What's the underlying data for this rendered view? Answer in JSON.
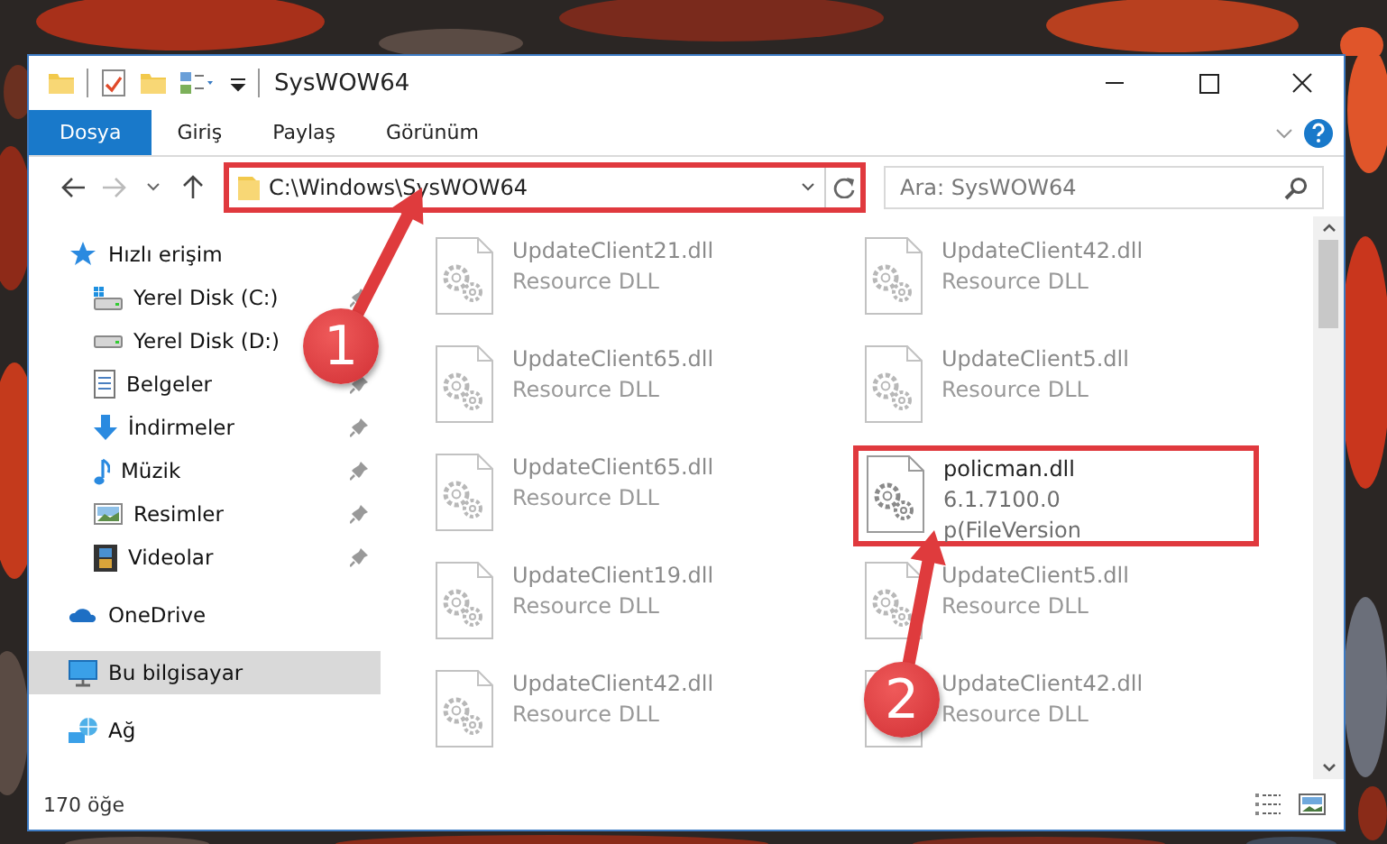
{
  "window": {
    "title": "SysWOW64"
  },
  "ribbon_tabs": [
    {
      "label": "Dosya",
      "selected": true
    },
    {
      "label": "Giriş",
      "selected": false
    },
    {
      "label": "Paylaş",
      "selected": false
    },
    {
      "label": "Görünüm",
      "selected": false
    }
  ],
  "address_bar": {
    "path": "C:\\Windows\\SysWOW64",
    "highlighted": true
  },
  "search": {
    "placeholder": "Ara: SysWOW64"
  },
  "sidebar": {
    "items": [
      {
        "label": "Hızlı erişim",
        "kind": "star",
        "selected": false,
        "children": [
          {
            "label": "Yerel Disk (C:)",
            "kind": "windrive",
            "pinned": true,
            "selected": false
          },
          {
            "label": "Yerel Disk (D:)",
            "kind": "drive",
            "selected": false
          },
          {
            "label": "Belgeler",
            "kind": "document",
            "pinned": true,
            "selected": false
          },
          {
            "label": "İndirmeler",
            "kind": "download",
            "pinned": true,
            "selected": false
          },
          {
            "label": "Müzik",
            "kind": "music",
            "pinned": true,
            "selected": false
          },
          {
            "label": "Resimler",
            "kind": "pictures",
            "pinned": true,
            "selected": false
          },
          {
            "label": "Videolar",
            "kind": "video",
            "pinned": true,
            "selected": false
          }
        ]
      },
      {
        "label": "OneDrive",
        "kind": "cloud",
        "selected": false
      },
      {
        "label": "Bu bilgisayar",
        "kind": "computer",
        "selected": true
      },
      {
        "label": "Ağ",
        "kind": "network",
        "selected": false
      }
    ]
  },
  "files": [
    {
      "name": "UpdateClient21.dll",
      "details": [
        "Resource DLL"
      ],
      "blurred": true,
      "highlighted": false
    },
    {
      "name": "UpdateClient42.dll",
      "details": [
        "Resource DLL"
      ],
      "blurred": true,
      "highlighted": false
    },
    {
      "name": "UpdateClient65.dll",
      "details": [
        "Resource DLL"
      ],
      "blurred": true,
      "highlighted": false
    },
    {
      "name": "UpdateClient5.dll",
      "details": [
        "Resource DLL"
      ],
      "blurred": true,
      "highlighted": false
    },
    {
      "name": "UpdateClient65.dll",
      "details": [
        "Resource DLL"
      ],
      "blurred": true,
      "highlighted": false
    },
    {
      "name": "policman.dll",
      "details": [
        "6.1.7100.0",
        "p(FileVersion"
      ],
      "blurred": false,
      "highlighted": true
    },
    {
      "name": "UpdateClient19.dll",
      "details": [
        "Resource DLL"
      ],
      "blurred": true,
      "highlighted": false
    },
    {
      "name": "UpdateClient5.dll",
      "details": [
        "Resource DLL"
      ],
      "blurred": true,
      "highlighted": false
    },
    {
      "name": "UpdateClient42.dll",
      "details": [
        "Resource DLL"
      ],
      "blurred": true,
      "highlighted": false
    },
    {
      "name": "UpdateClient42.dll",
      "details": [
        "Resource DLL"
      ],
      "blurred": true,
      "highlighted": false
    }
  ],
  "status_bar": {
    "item_count": "170 öğe"
  },
  "annotations": [
    {
      "number": "1"
    },
    {
      "number": "2"
    }
  ]
}
